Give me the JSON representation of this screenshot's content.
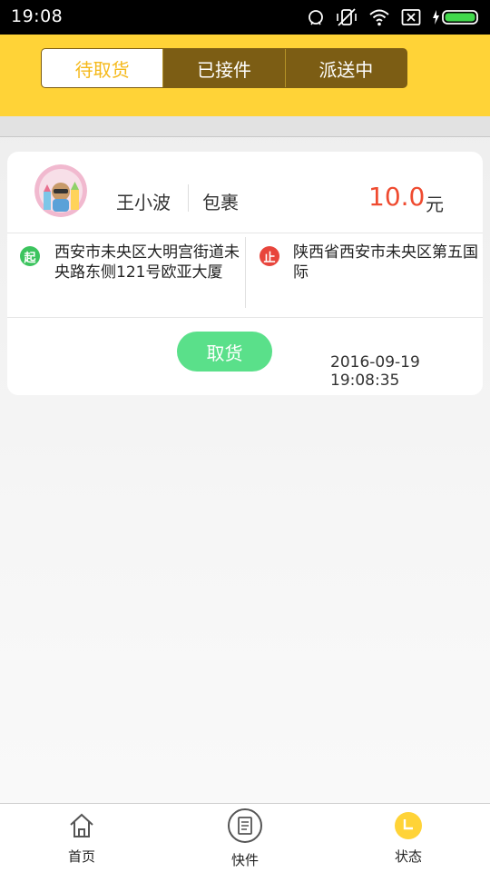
{
  "status_bar": {
    "time": "19:08"
  },
  "tabs": [
    {
      "label": "待取货",
      "active": true
    },
    {
      "label": "已接件",
      "active": false
    },
    {
      "label": "派送中",
      "active": false
    }
  ],
  "order": {
    "customer_name": "王小波",
    "item_type": "包裹",
    "price": "10.0",
    "price_unit": "元",
    "start_badge": "起",
    "start_address": "西安市未央区大明宫街道未央路东侧121号欧亚大厦",
    "end_badge": "止",
    "end_address": "陕西省西安市未央区第五国际",
    "pickup_button": "取货",
    "time": "2016-09-19 19:08:35"
  },
  "bottom_nav": [
    {
      "label": "首页",
      "icon": "home-icon"
    },
    {
      "label": "快件",
      "icon": "parcel-list-icon"
    },
    {
      "label": "状态",
      "icon": "clock-icon",
      "active": true
    }
  ],
  "colors": {
    "header_yellow": "#ffd337",
    "tab_dark": "#7c5d14",
    "active_tab_text": "#f5b91b",
    "price_red": "#ef4b30",
    "pickup_green": "#5ae08a",
    "start_green": "#3cc45e",
    "end_red": "#e8453c"
  }
}
